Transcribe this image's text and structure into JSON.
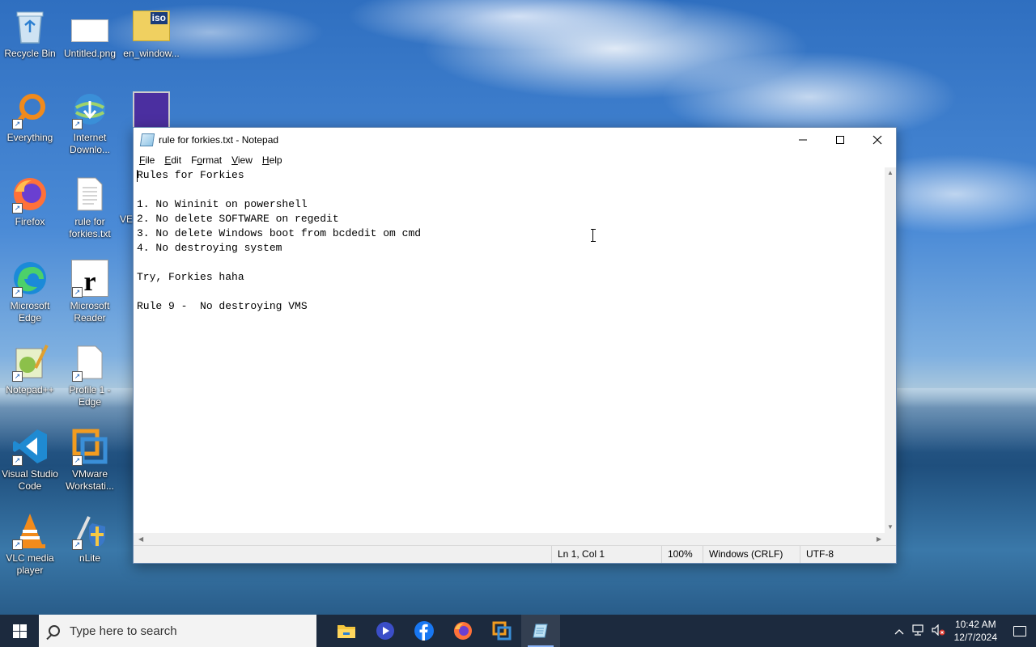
{
  "desktop": {
    "icons": [
      {
        "label": "Recycle Bin"
      },
      {
        "label": "Untitled.png"
      },
      {
        "label": "en_window..."
      },
      {
        "label": "Everything"
      },
      {
        "label": "Internet Downlo..."
      },
      {
        "label": "Firefox"
      },
      {
        "label": "rule for forkies.txt"
      },
      {
        "label": "VE"
      },
      {
        "label": "Microsoft Edge"
      },
      {
        "label": "Microsoft Reader"
      },
      {
        "label": "Notepad++"
      },
      {
        "label": "Profile 1 - Edge"
      },
      {
        "label": "Visual Studio Code"
      },
      {
        "label": "VMware Workstati..."
      },
      {
        "label": "VLC media player"
      },
      {
        "label": "nLite"
      }
    ],
    "iso_badge": "iso"
  },
  "notepad": {
    "title": "rule for forkies.txt - Notepad",
    "menu": [
      "File",
      "Edit",
      "Format",
      "View",
      "Help"
    ],
    "menu_mnemonics": [
      "F",
      "E",
      "o",
      "V",
      "H"
    ],
    "content": "Rules for Forkies\n\n1. No Wininit on powershell\n2. No delete SOFTWARE on regedit\n3. No delete Windows boot from bcdedit om cmd\n4. No destroying system\n\nTry, Forkies haha\n\nRule 9 -  No destroying VMS",
    "status": {
      "position": "Ln 1, Col 1",
      "zoom": "100%",
      "line_ending": "Windows (CRLF)",
      "encoding": "UTF-8"
    }
  },
  "taskbar": {
    "search_placeholder": "Type here to search",
    "apps": [
      "File Explorer",
      "Clipchamp",
      "Facebook",
      "Firefox",
      "VMware Workstation",
      "Notepad"
    ],
    "clock": {
      "time": "10:42 AM",
      "date": "12/7/2024"
    }
  },
  "colors": {
    "taskbar": "#1c2a3e",
    "accent": "#8ab4f8"
  }
}
